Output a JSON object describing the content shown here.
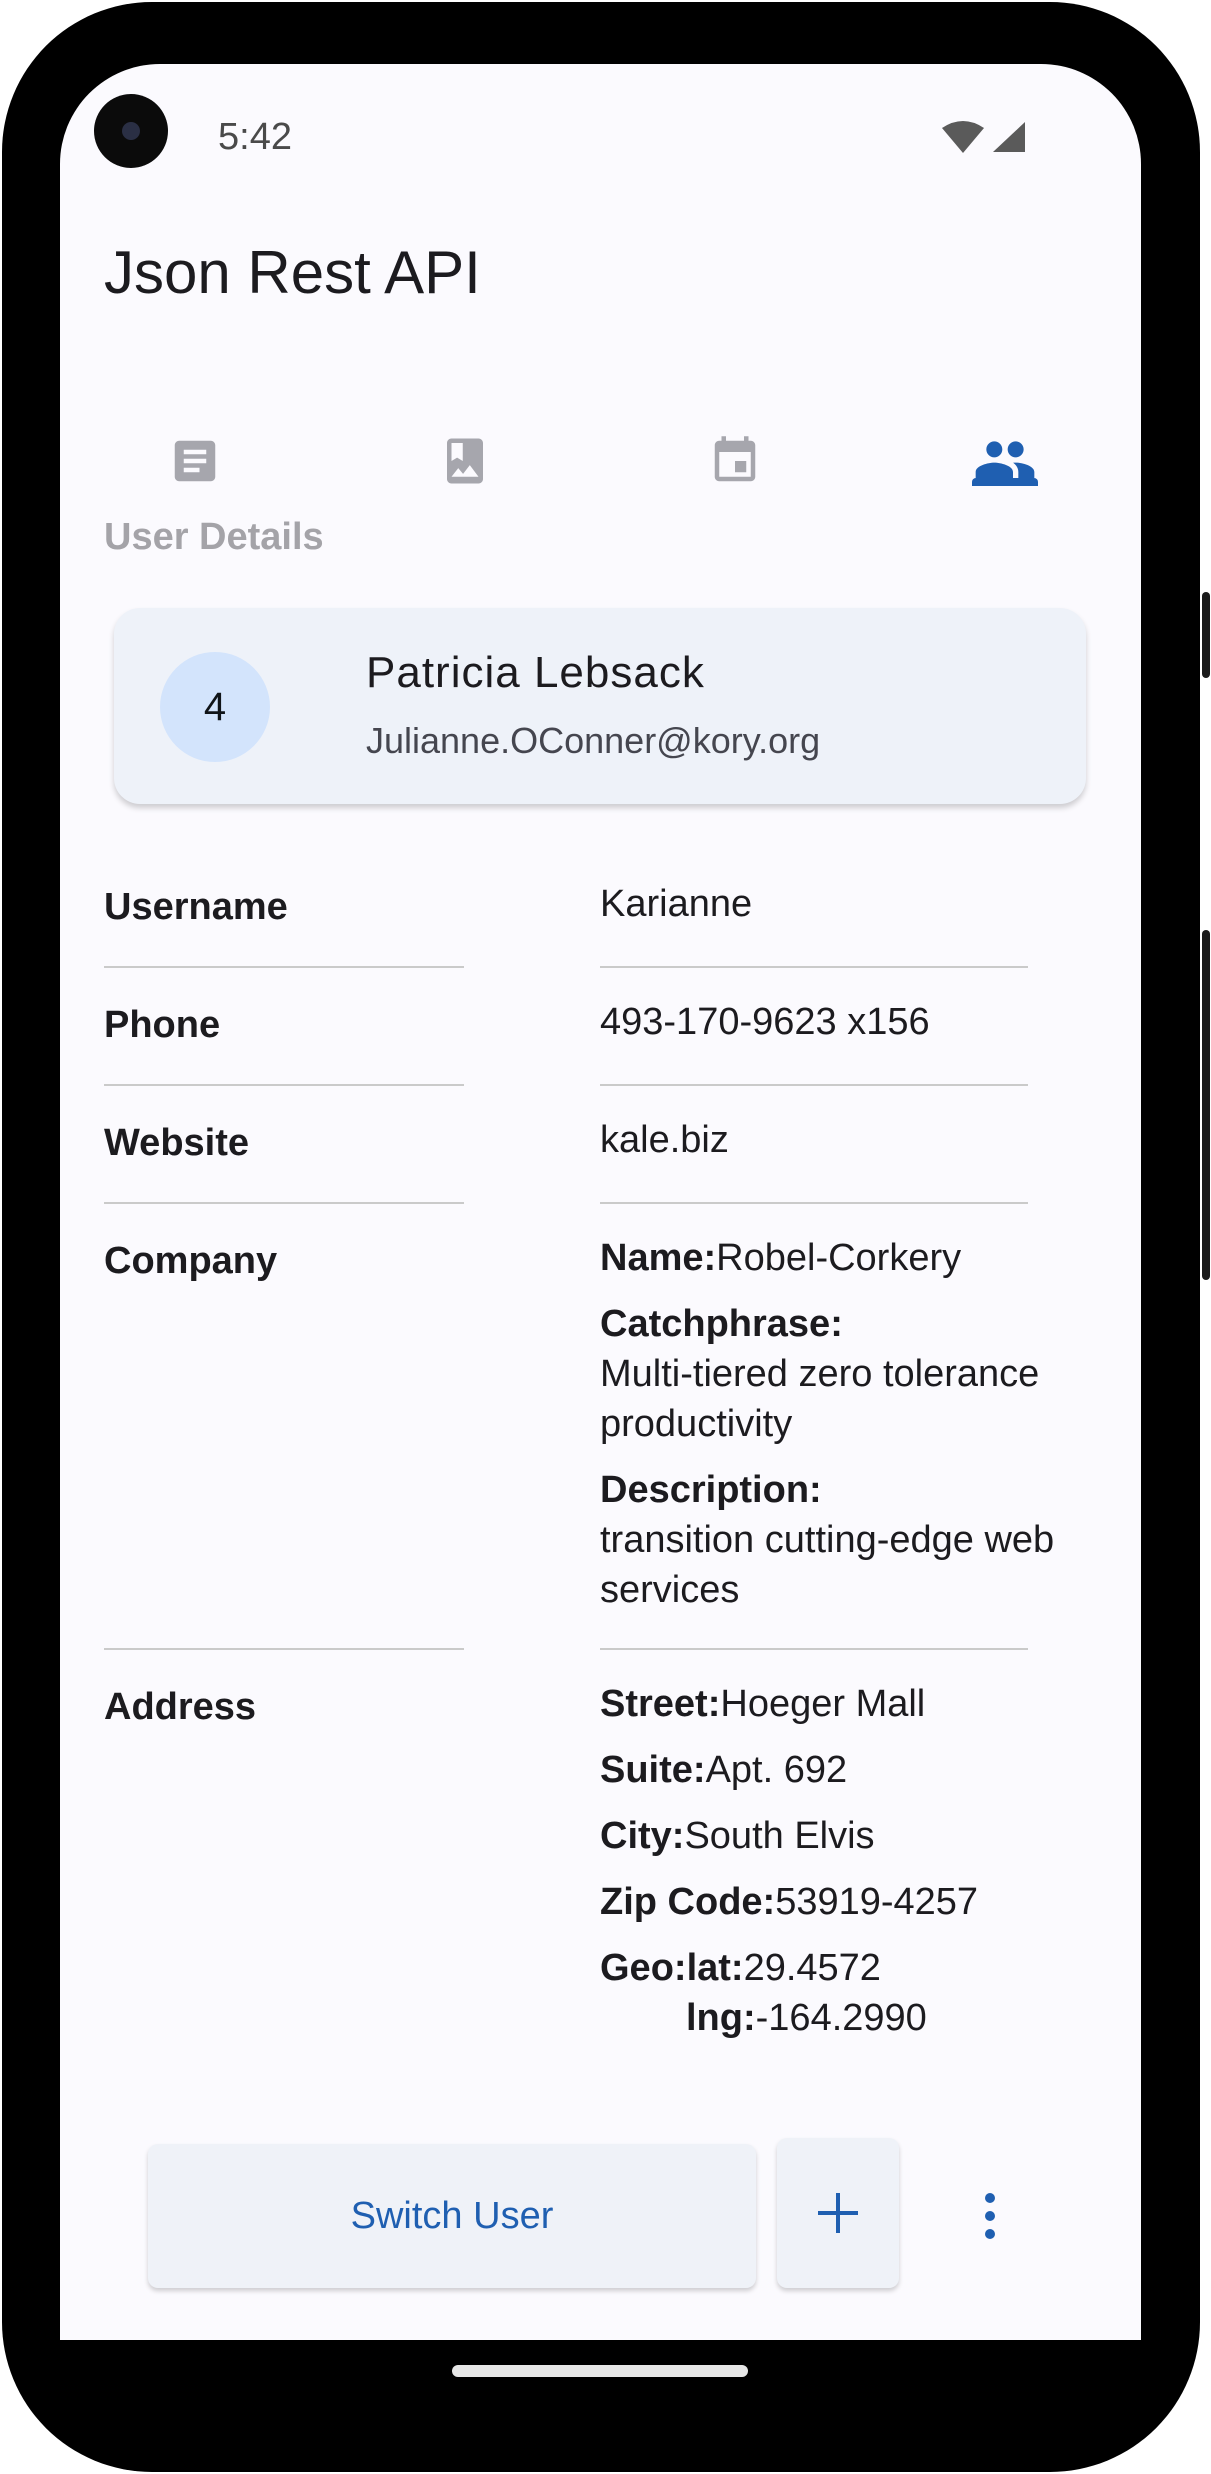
{
  "status_bar": {
    "time": "5:42",
    "icons": [
      "wifi-icon",
      "cellular-signal-icon"
    ]
  },
  "app": {
    "title": "Json Rest API"
  },
  "tabs": [
    {
      "icon": "article-icon",
      "selected": false
    },
    {
      "icon": "photo-album-icon",
      "selected": false
    },
    {
      "icon": "calendar-icon",
      "selected": false
    },
    {
      "icon": "people-icon",
      "selected": true
    }
  ],
  "colors": {
    "accent": "#1f5fb1",
    "tab_inactive": "#9e9ea6",
    "card_bg": "#eef2f9",
    "avatar_bg": "#d3e4fc"
  },
  "user_details": {
    "section_label": "User Details",
    "user_id": "4",
    "name": "Patricia Lebsack",
    "email": "Julianne.OConner@kory.org"
  },
  "fields": {
    "username": {
      "label": "Username",
      "value": "Karianne"
    },
    "phone": {
      "label": "Phone",
      "value": "493-170-9623 x156"
    },
    "website": {
      "label": "Website",
      "value": "kale.biz"
    },
    "company": {
      "label": "Company",
      "name_label": "Name:",
      "name_value": "Robel-Corkery",
      "catchphrase_label": "Catchphrase:",
      "catchphrase_value": "Multi-tiered zero tolerance productivity",
      "description_label": "Description:",
      "description_value": "transition cutting-edge web services"
    },
    "address": {
      "label": "Address",
      "street_label": "Street:",
      "street_value": "Hoeger Mall",
      "suite_label": "Suite:",
      "suite_value": "Apt. 692",
      "city_label": "City:",
      "city_value": "South Elvis",
      "zip_label": "Zip Code:",
      "zip_value": "53919-4257",
      "geo_label": "Geo:",
      "lat_label": "lat:",
      "lat_value": "29.4572",
      "lng_label": "lng:",
      "lng_value": "-164.2990"
    }
  },
  "bottom_bar": {
    "switch_user_label": "Switch User",
    "add_icon": "plus-icon",
    "more_icon": "more-vert-icon"
  }
}
